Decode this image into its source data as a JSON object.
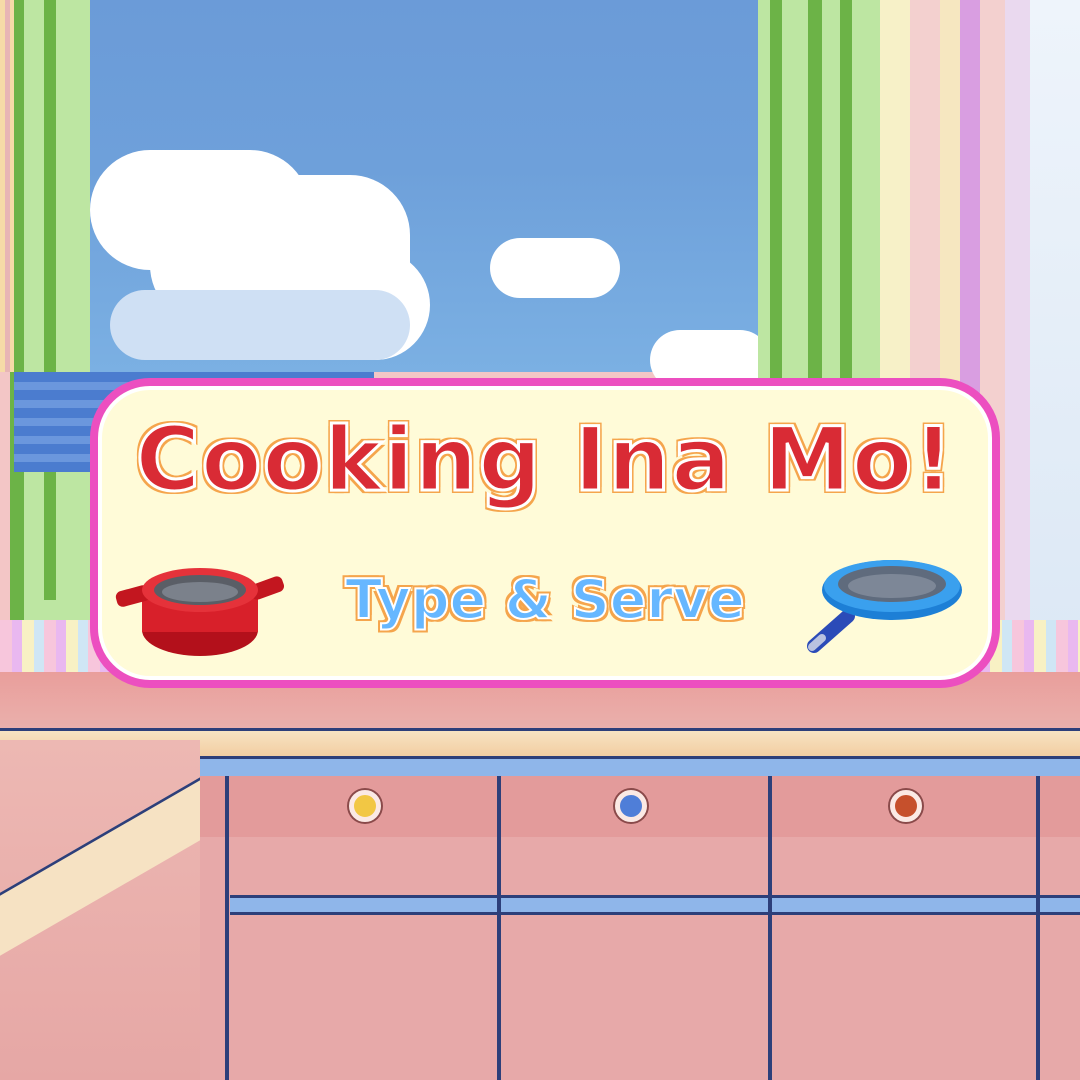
{
  "logo": {
    "title": "Cooking Ina Mo!",
    "subtitle": "Type & Serve",
    "pot_icon": "pot-icon",
    "pan_icon": "frying-pan-icon"
  },
  "cabinet_knobs": [
    {
      "color": "#f2c744"
    },
    {
      "color": "#4f7ed8"
    },
    {
      "color": "#c6502c"
    }
  ],
  "colors": {
    "sky": "#6b9bd8",
    "title_red": "#d92b35",
    "subtitle_blue": "#66b7ff",
    "logo_border_pink": "#ec4fc0",
    "cabinet_pink": "#e7a9a9"
  }
}
